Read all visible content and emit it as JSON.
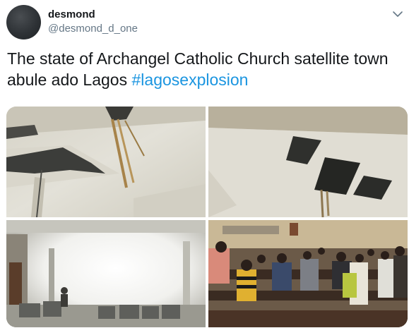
{
  "author": {
    "display_name": "desmond",
    "handle": "@desmond_d_one"
  },
  "tweet": {
    "text": "The state of Archangel Catholic Church satellite town abule ado Lagos ",
    "hashtag": "#lagosexplosion"
  },
  "icons": {
    "menu": "chevron-down-icon"
  },
  "colors": {
    "link": "#1b95e0",
    "handle": "#657786"
  }
}
